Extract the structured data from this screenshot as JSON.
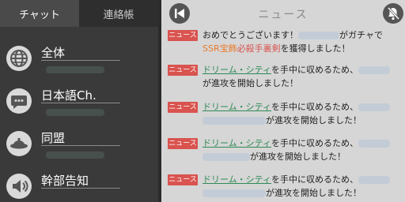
{
  "tabs": {
    "chat": "チャット",
    "contacts": "連絡帳"
  },
  "channels": [
    {
      "name": "全体",
      "icon": "globe-icon"
    },
    {
      "name": "日本語Ch.",
      "icon": "speech-bubble-icon"
    },
    {
      "name": "同盟",
      "icon": "alliance-helmet-icon"
    },
    {
      "name": "幹部告知",
      "icon": "speaker-icon"
    }
  ],
  "news_panel": {
    "title": "ニュース",
    "badge": "ニュース",
    "messages": [
      {
        "l1a": "おめでとうございます！",
        "l1b": "がガチャで",
        "l2a": "SSR宝飾",
        "l2b": "必殺手裏剣",
        "l2c": "を獲得しました！"
      },
      {
        "l1a": "ドリーム・シティ",
        "l1b": "を手中に収めるため、",
        "l2a": "が進攻を開始しました！"
      },
      {
        "l1a": "ドリーム・シティ",
        "l1b": "を手中に収めるため、",
        "l2a": "が進攻を開始しました！"
      },
      {
        "l1a": "ドリーム・シティ",
        "l1b": "を手中に収めるため、",
        "l2a": "が進攻を開始しました！"
      },
      {
        "l1a": "ドリーム・シティ",
        "l1b": "を手中に収めるため、",
        "l2a": "が進攻を開始しました！"
      }
    ]
  },
  "colors": {
    "badge": "#d9534f",
    "city_link": "#2f8a55",
    "ssr": "#e87a2a",
    "item": "#d9534f"
  }
}
